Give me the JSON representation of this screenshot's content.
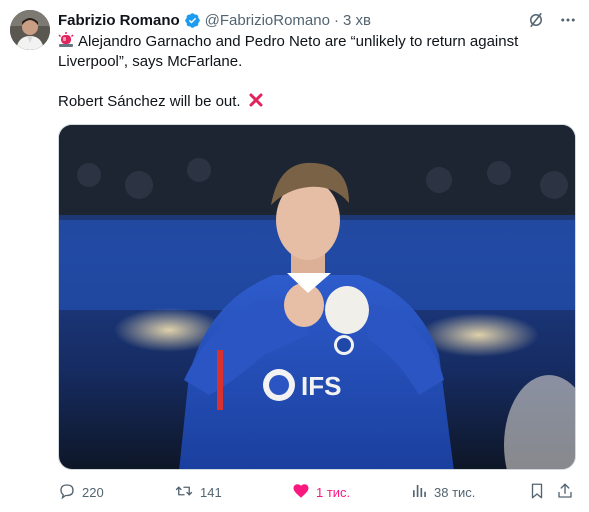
{
  "author": {
    "name": "Fabrizio Romano",
    "handle": "@FabrizioRomano",
    "separator": "·",
    "time": "3 хв",
    "verified_color": "#1d9bf0"
  },
  "tweet": {
    "line1": "Alejandro Garnacho and Pedro Neto are “unlikely to return against Liverpool”, says McFarlane.",
    "line2": "Robert Sánchez will be out.",
    "siren_icon": "police-light-emoji",
    "cross_icon": "red-cross-emoji",
    "jersey_sponsor": "IFS"
  },
  "actions": {
    "replies": "220",
    "reposts": "141",
    "likes": "1 тис.",
    "views": "38 тис.",
    "like_color": "#f91880"
  },
  "colors": {
    "text": "#0f1419",
    "muted": "#536471",
    "jersey": "#1f48a8"
  }
}
